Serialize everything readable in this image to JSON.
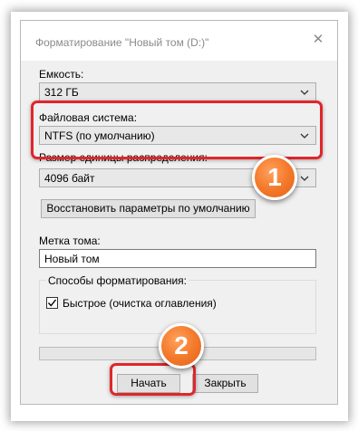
{
  "dialog": {
    "title": "Форматирование \"Новый том (D:)\"",
    "close_icon": "close-icon"
  },
  "capacity": {
    "label": "Емкость:",
    "value": "312 ГБ"
  },
  "filesystem": {
    "label": "Файловая система:",
    "value": "NTFS (по умолчанию)"
  },
  "allocation": {
    "label": "Размер единицы распределения:",
    "value": "4096 байт"
  },
  "restore_defaults_label": "Восстановить параметры по умолчанию",
  "volume_label": {
    "label": "Метка тома:",
    "value": "Новый том"
  },
  "format_options": {
    "label": "Способы форматирования:",
    "quick_format": {
      "label": "Быстрое (очистка оглавления)",
      "checked": true
    }
  },
  "progress": {
    "value": 0
  },
  "buttons": {
    "start": "Начать",
    "close": "Закрыть"
  },
  "annotations": {
    "badge_1": "1",
    "badge_2": "2",
    "highlight_color": "#e0262b",
    "badge_color": "#f47a2b"
  }
}
